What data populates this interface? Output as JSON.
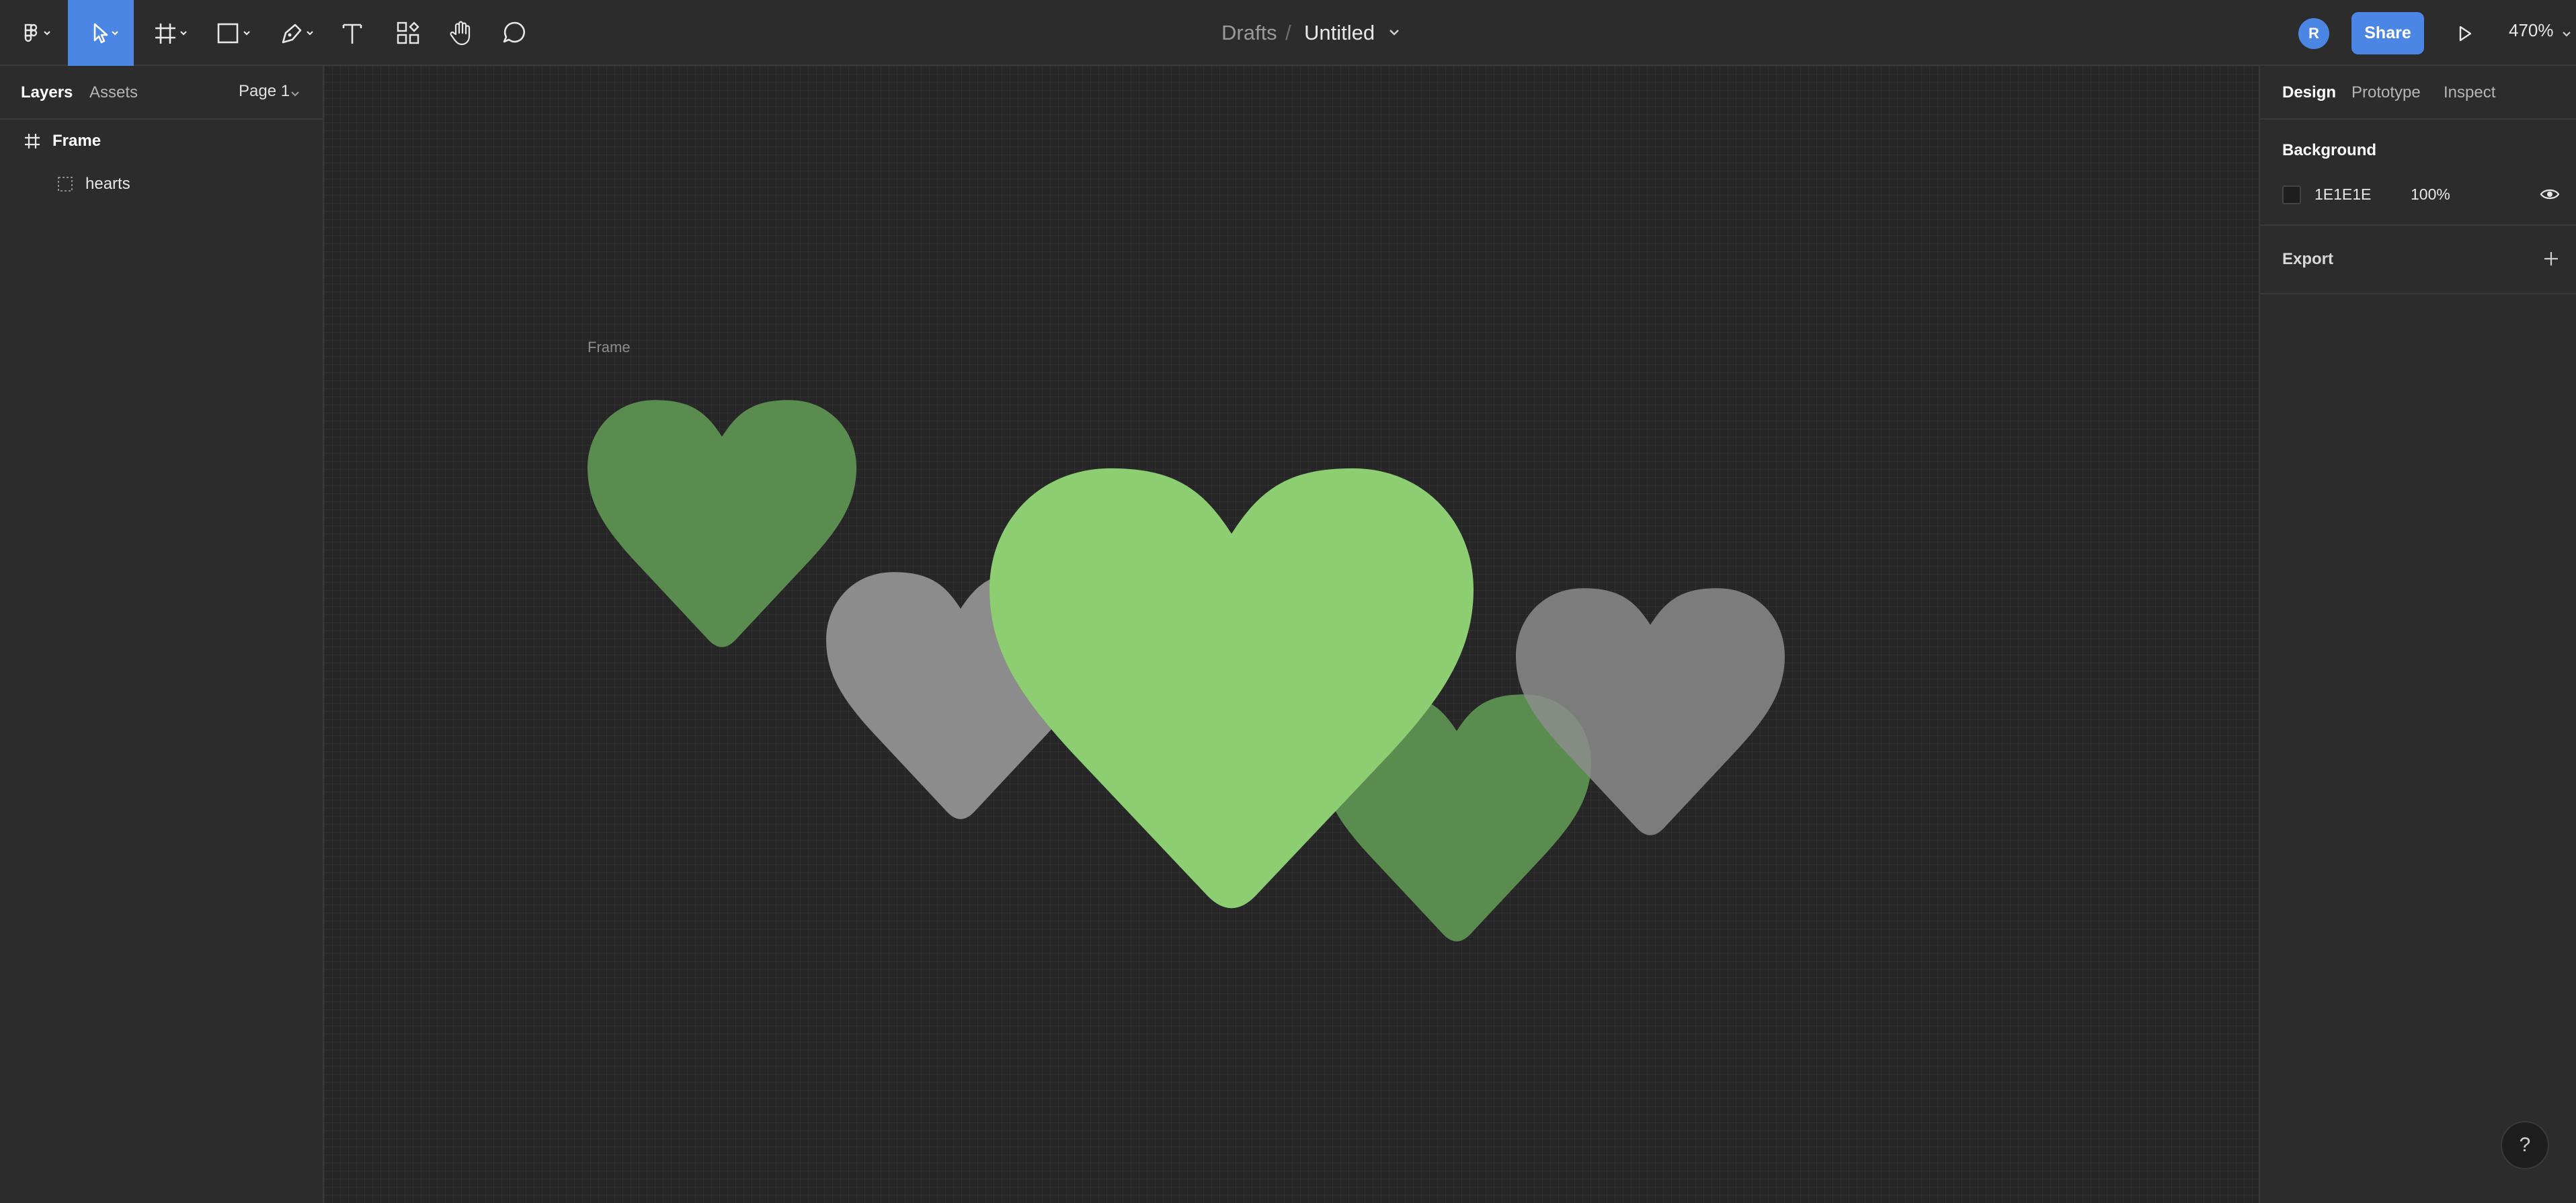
{
  "toolbar": {
    "main_menu_icon": "figma-logo-icon",
    "tools": [
      {
        "name": "move-tool",
        "icon": "cursor-icon",
        "active": true
      },
      {
        "name": "frame-tool",
        "icon": "frame-hash-icon"
      },
      {
        "name": "shape-tool",
        "icon": "rectangle-icon"
      },
      {
        "name": "pen-tool",
        "icon": "pen-icon"
      },
      {
        "name": "text-tool",
        "icon": "text-icon"
      },
      {
        "name": "resources-tool",
        "icon": "components-icon"
      },
      {
        "name": "hand-tool",
        "icon": "hand-icon"
      },
      {
        "name": "comment-tool",
        "icon": "comment-icon"
      }
    ],
    "breadcrumb_drafts": "Drafts",
    "breadcrumb_sep": "/",
    "file_name": "Untitled",
    "avatar_initial": "R",
    "share_label": "Share",
    "zoom_label": "470%",
    "accent": "#4b86e4"
  },
  "left_panel": {
    "tab_layers": "Layers",
    "tab_assets": "Assets",
    "page_label": "Page 1",
    "layers": [
      {
        "label": "Frame",
        "icon": "frame-hash-icon"
      },
      {
        "label": "hearts",
        "icon": "group-dashed-icon"
      }
    ]
  },
  "canvas": {
    "frame_label": "Frame",
    "hearts": [
      {
        "name": "heart-green-small-left",
        "color": "#5b8c4f"
      },
      {
        "name": "heart-gray-left",
        "color": "#8c8c8c"
      },
      {
        "name": "heart-green-small-right",
        "color": "#5b8c4f"
      },
      {
        "name": "heart-gray-right",
        "color": "#8c8c8c"
      },
      {
        "name": "heart-green-large",
        "color": "#8cce71"
      }
    ]
  },
  "right_panel": {
    "tab_design": "Design",
    "tab_prototype": "Prototype",
    "tab_inspect": "Inspect",
    "background_title": "Background",
    "background_hex": "1E1E1E",
    "background_opacity": "100%",
    "background_color": "#1e1e1e",
    "export_title": "Export"
  },
  "help_label": "?"
}
